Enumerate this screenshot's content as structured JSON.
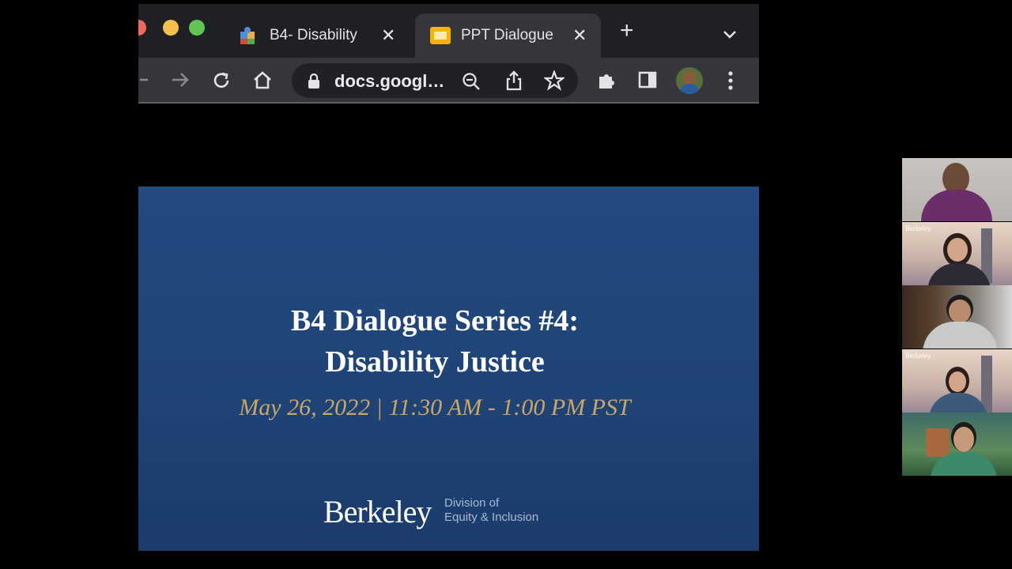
{
  "browser": {
    "tabs": [
      {
        "title": "B4- Disability",
        "close": "✕",
        "favicon": "puzzle-icon"
      },
      {
        "title": "PPT Dialogue",
        "close": "✕",
        "favicon": "slides-icon"
      }
    ],
    "new_tab": "+",
    "tab_menu": "⌄",
    "url": "docs.googl…",
    "colors": {
      "tabstrip": "#1f2023",
      "toolbar": "#35363a"
    }
  },
  "slide": {
    "title_line1": "B4 Dialogue Series #4:",
    "title_line2": "Disability Justice",
    "date": "May 26, 2022 | 11:30 AM - 1:00 PM PST",
    "brand": "Berkeley",
    "division_line1": "Division of",
    "division_line2": "Equity & Inclusion",
    "colors": {
      "background": "#1f4375",
      "date": "#caa66a"
    }
  },
  "participants": [
    {
      "background_label": ""
    },
    {
      "background_label": "Berkeley"
    },
    {
      "background_label": ""
    },
    {
      "background_label": "Berkeley"
    },
    {
      "background_label": ""
    }
  ]
}
